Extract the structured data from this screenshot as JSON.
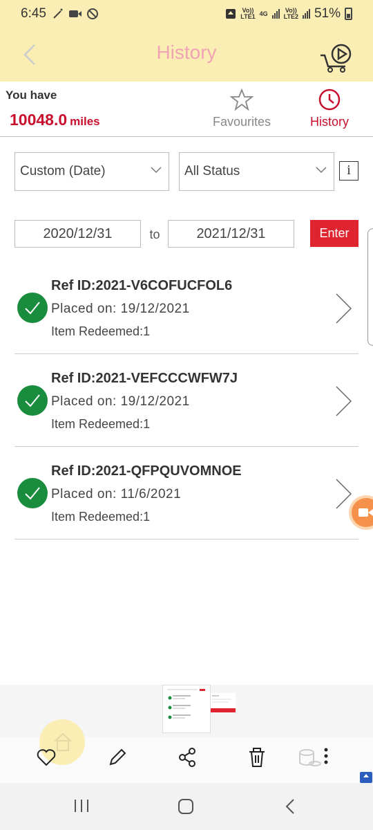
{
  "status_bar": {
    "time": "6:45",
    "sim1_label_top": "Vo))",
    "sim1_label_bottom": "LTE1",
    "net_type_top": "4G",
    "sim2_label_top": "Vo))",
    "sim2_label_bottom": "LTE2",
    "battery": "51%"
  },
  "header": {
    "title": "History",
    "back_icon": "chevron-left-icon",
    "cart_icon": "cart-play-icon"
  },
  "account": {
    "you_have": "You have",
    "miles_value": "10048.0",
    "miles_unit": "miles"
  },
  "tabs": {
    "favourites": "Favourites",
    "history": "History"
  },
  "filters": {
    "date_filter": "Custom (Date)",
    "status_filter": "All Status",
    "info": "i"
  },
  "date_range": {
    "from": "2020/12/31",
    "to_label": "to",
    "to": "2021/12/31",
    "enter": "Enter"
  },
  "orders": [
    {
      "ref": "Ref ID:2021-V6COFUCFOL6",
      "placed": "Placed on: 19/12/2021",
      "items": "Item Redeemed:1"
    },
    {
      "ref": "Ref ID:2021-VEFCCCWFW7J",
      "placed": "Placed on: 19/12/2021",
      "items": "Item Redeemed:1"
    },
    {
      "ref": "Ref ID:2021-QFPQUVOMNOE",
      "placed": "Placed on: 11/6/2021",
      "items": "Item Redeemed:1"
    }
  ],
  "colors": {
    "header_bg": "#fbeeb4",
    "brand_red": "#c8102e",
    "enter_red": "#e0242f",
    "check_green": "#1a8c3e",
    "title_pink": "#f0a3b4"
  }
}
